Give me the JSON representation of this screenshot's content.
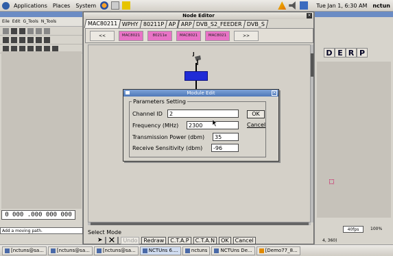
{
  "top_panel": {
    "menus": [
      "Applications",
      "Places",
      "System"
    ],
    "datetime": "Tue Jan 1,  6:30 AM",
    "user": "nctun"
  },
  "left_app": {
    "menu_items": [
      "Eile",
      "Edit",
      "G_Tools",
      "N_Tools"
    ],
    "coords": "0 000 .000 000 000",
    "status": "Add a moving path."
  },
  "right_app": {
    "letters": [
      "D",
      "E",
      "R",
      "P"
    ],
    "zoom_speed": "40fps",
    "zoom_pct": "100%",
    "coord": "4, 360)"
  },
  "node_editor": {
    "title": "Node Editor",
    "tabs": [
      "MAC80211",
      "WPHY",
      "80211P",
      "AP",
      "ARP",
      "DVB_S2_FEEDER",
      "DVB_S"
    ],
    "nav_prev": "<<",
    "nav_next": ">>",
    "module_buttons": [
      "MAC8021",
      "80211e",
      "MAC8021",
      "MAC8021"
    ],
    "node_label": "J",
    "select_mode": "Select Mode",
    "bottom_buttons": {
      "undo": "Undo",
      "redraw": "Redraw",
      "ctap": "C.T.A.P",
      "ctan": "C.T.A.N",
      "ok": "OK",
      "cancel": "Cancel"
    }
  },
  "module_edit": {
    "title": "Module Edit",
    "group_title": "Parameters Setting",
    "fields": [
      {
        "label": "Channel ID",
        "value": "2"
      },
      {
        "label": "Frequency (MHz)",
        "value": "2300"
      },
      {
        "label": "Transmission Power (dbm)",
        "value": "35"
      },
      {
        "label": "Receive Sensitivity (dbm)",
        "value": "-96"
      }
    ],
    "ok": "OK",
    "cancel": "Cancel"
  },
  "taskbar": {
    "items": [
      "[nctuns@sa...",
      "[nctuns@sa...",
      "[nctuns@sa...",
      "NCTUns 6....",
      "nctuns",
      "NCTUns De...",
      "[Demo77_8..."
    ]
  },
  "colors": {
    "module_button": "#e873c6",
    "module_block": "#1f2bd6",
    "titlebar": "#4f78b8"
  }
}
